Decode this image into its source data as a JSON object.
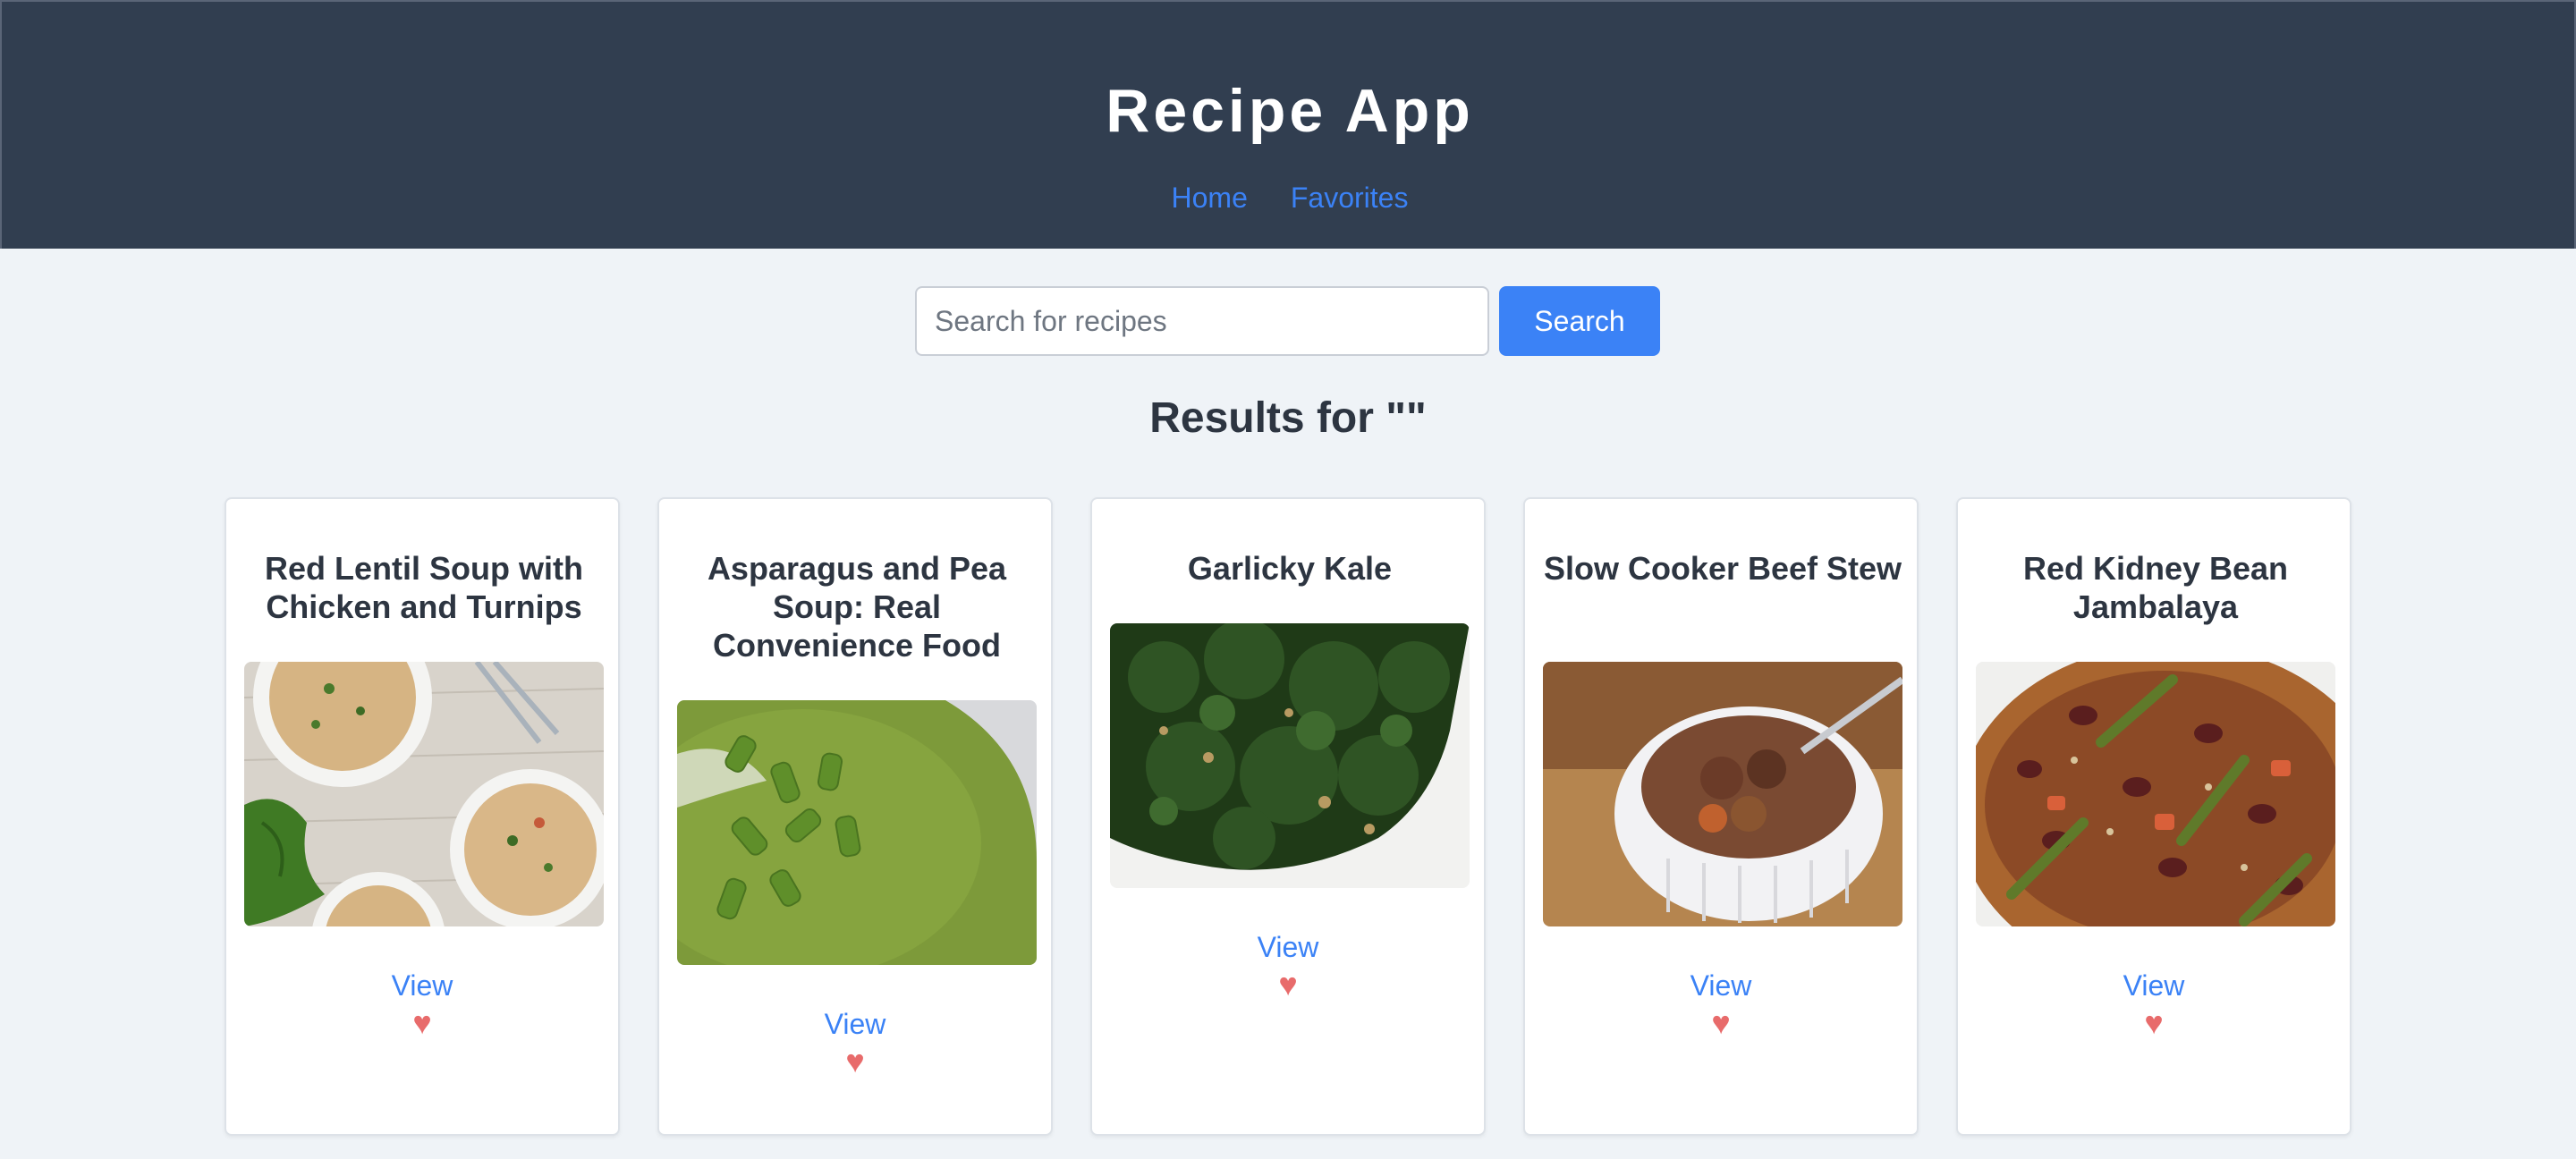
{
  "app": {
    "title": "Recipe App",
    "nav": [
      {
        "label": "Home"
      },
      {
        "label": "Favorites"
      }
    ]
  },
  "search": {
    "placeholder": "Search for recipes",
    "value": "",
    "button_label": "Search"
  },
  "results": {
    "heading": "Results for \"\"",
    "recipes": [
      {
        "title": "Red Lentil Soup with Chicken and Turnips",
        "view_label": "View",
        "favorite_icon": "♥",
        "image_icon": "soup-bowls-image"
      },
      {
        "title": "Asparagus and Pea Soup: Real Convenience Food",
        "view_label": "View",
        "favorite_icon": "♥",
        "image_icon": "green-soup-image"
      },
      {
        "title": "Garlicky Kale",
        "view_label": "View",
        "favorite_icon": "♥",
        "image_icon": "kale-image"
      },
      {
        "title": "Slow Cooker Beef Stew",
        "view_label": "View",
        "favorite_icon": "♥",
        "image_icon": "beef-stew-image"
      },
      {
        "title": "Red Kidney Bean Jambalaya",
        "view_label": "View",
        "favorite_icon": "♥",
        "image_icon": "jambalaya-image"
      }
    ]
  },
  "colors": {
    "header_bg": "#313e50",
    "accent": "#3b82f6",
    "page_bg": "#eff3f7",
    "heart": "#e86b6b"
  }
}
